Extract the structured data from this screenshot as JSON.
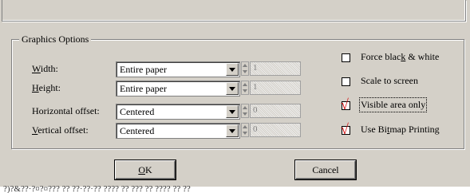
{
  "group": {
    "title": "Graphics Options"
  },
  "fields": [
    {
      "label_pre": "",
      "label_u": "W",
      "label_post": "idth:",
      "value": "Entire paper",
      "number": "1"
    },
    {
      "label_pre": "",
      "label_u": "H",
      "label_post": "eight:",
      "value": "Entire paper",
      "number": "1"
    },
    {
      "label_pre": "Horizontal offset:",
      "label_u": "",
      "label_post": "",
      "value": "Centered",
      "number": "0"
    },
    {
      "label_pre": "",
      "label_u": "V",
      "label_post": "ertical offset:",
      "value": "Centered",
      "number": "0"
    }
  ],
  "options": [
    {
      "label_pre": "Force blac",
      "label_u": "k",
      "label_post": " & white",
      "checked": false
    },
    {
      "label_pre": "Scale to screen",
      "label_u": "",
      "label_post": "",
      "checked": false
    },
    {
      "label_pre": "Visible area only",
      "label_u": "",
      "label_post": "",
      "checked": true
    },
    {
      "label_pre": "Use Bi",
      "label_u": "t",
      "label_post": "map Printing",
      "checked": true
    }
  ],
  "buttons": {
    "ok_u": "O",
    "ok_post": "K",
    "cancel": "Cancel"
  },
  "check_glyph": "√",
  "bottom_text": "?)?&??·?¤?¤??? ?? ??·??·?? ???? ?? ??? ?? ???? ?? ??"
}
